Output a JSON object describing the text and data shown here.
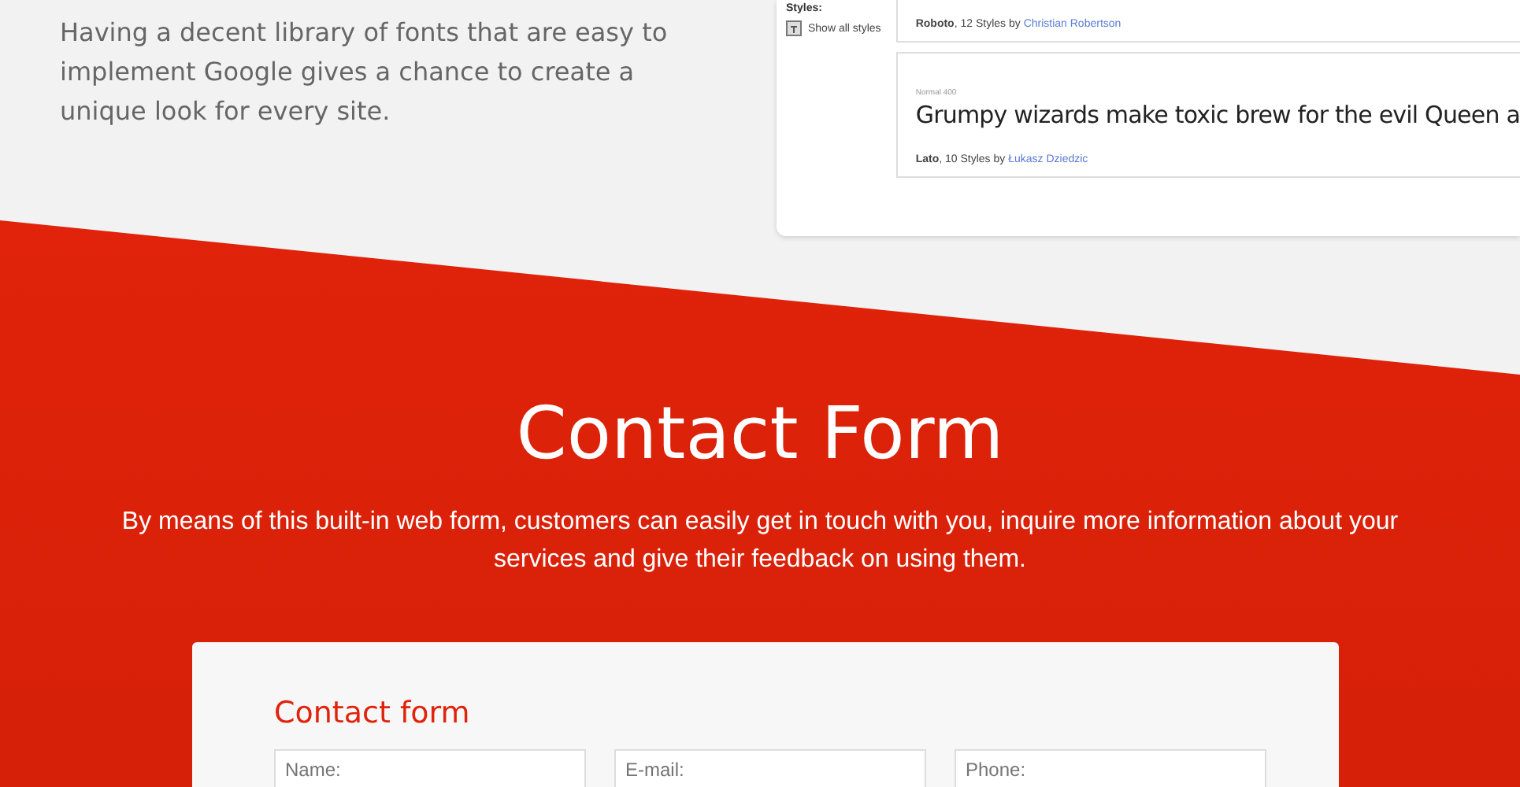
{
  "intro": {
    "text": "Having a decent library of fonts that are easy to implement Google gives a chance to create a unique look for every site."
  },
  "fonts_preview": {
    "sidebar": {
      "heading": "Styles:",
      "link": "Show all styles"
    },
    "cards": [
      {
        "family": "Roboto",
        "meta": ", 12 Styles by ",
        "author": "Christian Robertson"
      },
      {
        "sample_style": "Normal 400",
        "sample": "Grumpy wizards make toxic brew for the evil Queen a",
        "family": "Lato",
        "meta": ", 10 Styles by ",
        "author": "Łukasz Dziedzic"
      }
    ]
  },
  "contact": {
    "title": "Contact Form",
    "description": "By means of this built-in web form, customers can easily get in touch with you, inquire more information about your services and give their feedback on using them.",
    "form": {
      "title": "Contact form",
      "fields": [
        {
          "placeholder": "Name:"
        },
        {
          "placeholder": "E-mail:"
        },
        {
          "placeholder": "Phone:"
        }
      ]
    }
  }
}
